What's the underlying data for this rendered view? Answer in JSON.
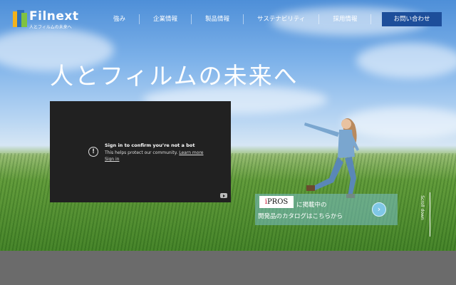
{
  "brand": {
    "name": "Filnext",
    "tagline": "人とフィルムの未来へ"
  },
  "nav": {
    "items": [
      "強み",
      "企業情報",
      "製品情報",
      "サステナビリティ",
      "採用情報"
    ],
    "contact_label": "お問い合わせ"
  },
  "hero": {
    "headline": "人とフィルムの未来へ"
  },
  "video": {
    "title": "Sign in to confirm you’re not a bot",
    "message": "This helps protect our community.",
    "learn_more": "Learn more",
    "sign_in": "Sign in"
  },
  "banner": {
    "logo": "iPROS",
    "line1": "に掲載中の",
    "line2": "開発品のカタログはこちらから"
  },
  "scroll": {
    "label": "Scroll down"
  },
  "colors": {
    "accent": "#1d4e9a",
    "video_bg": "#212121"
  }
}
